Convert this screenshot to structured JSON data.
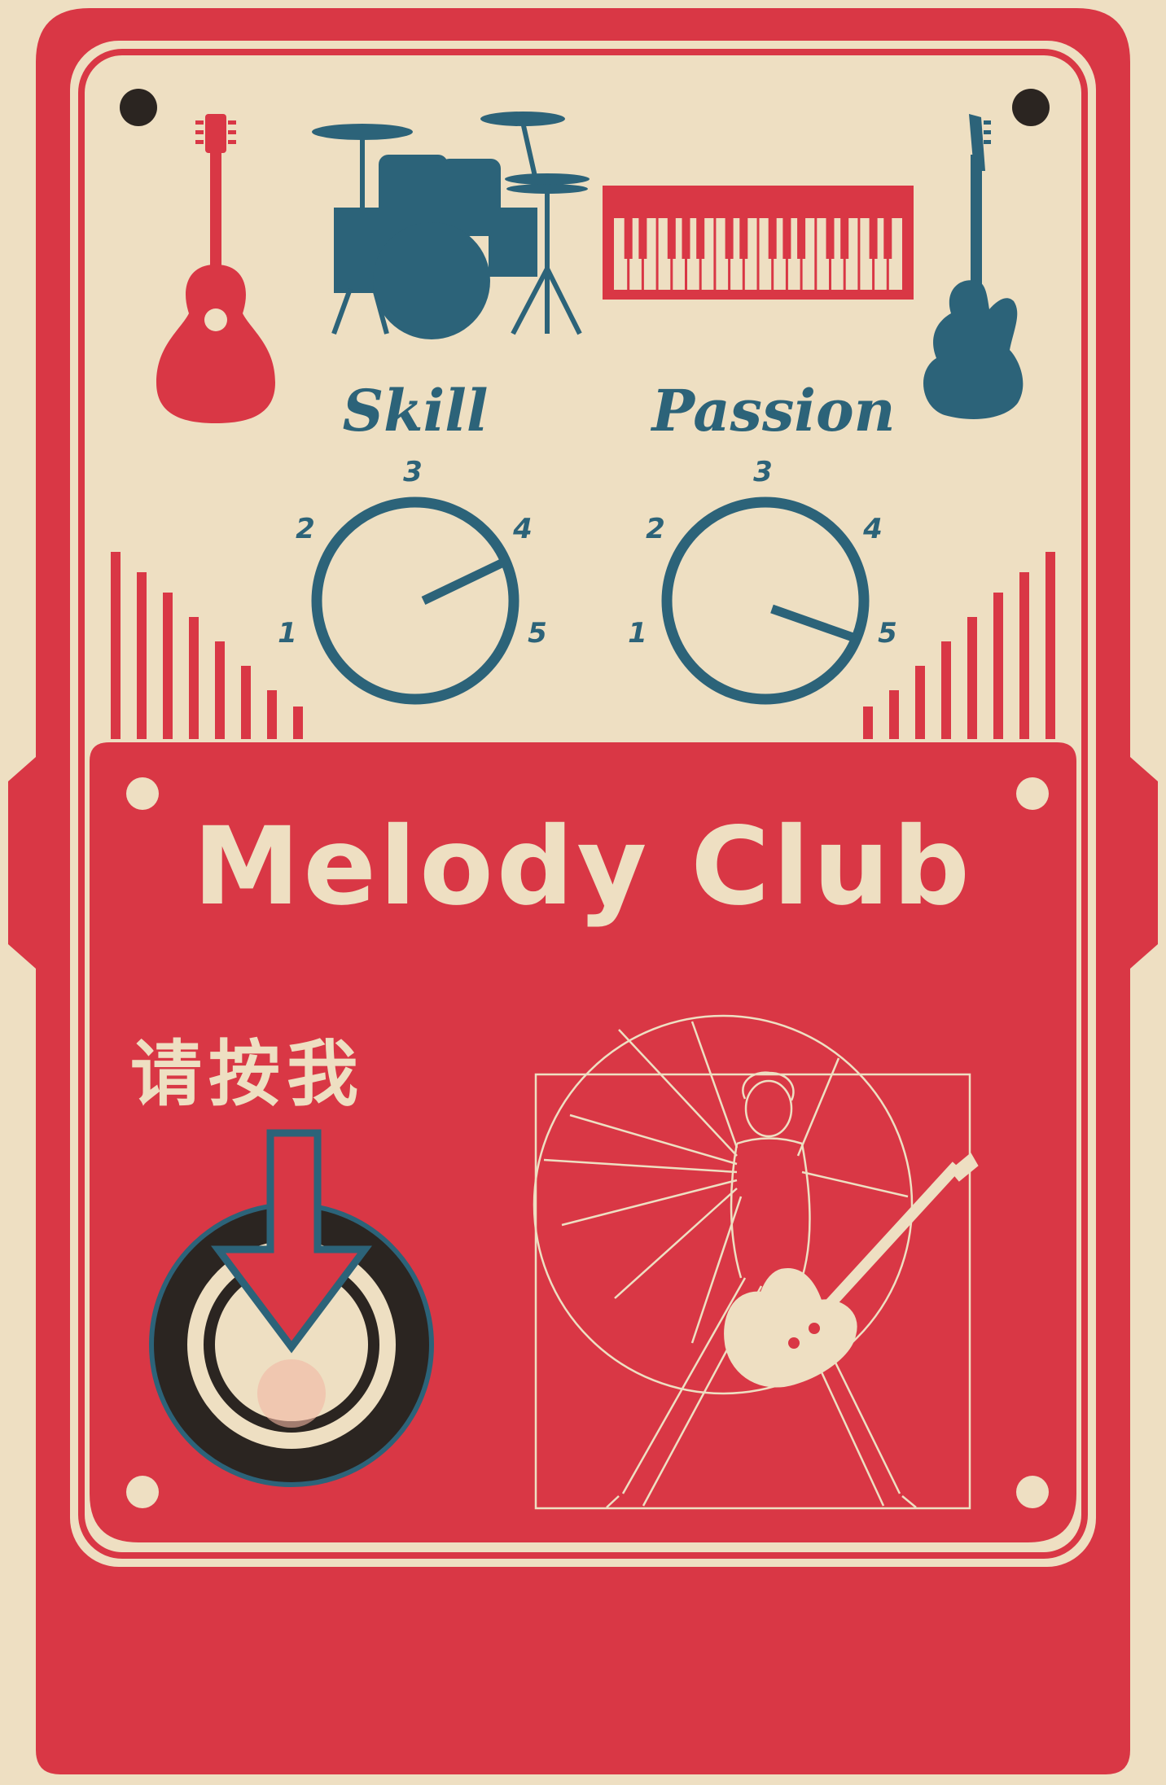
{
  "brand": {
    "title": "Melody Club",
    "press_label": "请按我"
  },
  "knobs": [
    {
      "label": "Skill",
      "scale": [
        "1",
        "2",
        "3",
        "4",
        "5"
      ],
      "value": 4.1
    },
    {
      "label": "Passion",
      "scale": [
        "1",
        "2",
        "3",
        "4",
        "5"
      ],
      "value": 4.9
    }
  ],
  "colors": {
    "cream": "#eedfc2",
    "red": "#d93745",
    "teal": "#2c6379",
    "dark": "#2b2521"
  },
  "icons": [
    "acoustic-guitar-icon",
    "drum-kit-icon",
    "keyboard-icon",
    "electric-guitar-icon",
    "power-button-icon",
    "arrow-down-icon",
    "vitruvian-guitarist-icon"
  ]
}
